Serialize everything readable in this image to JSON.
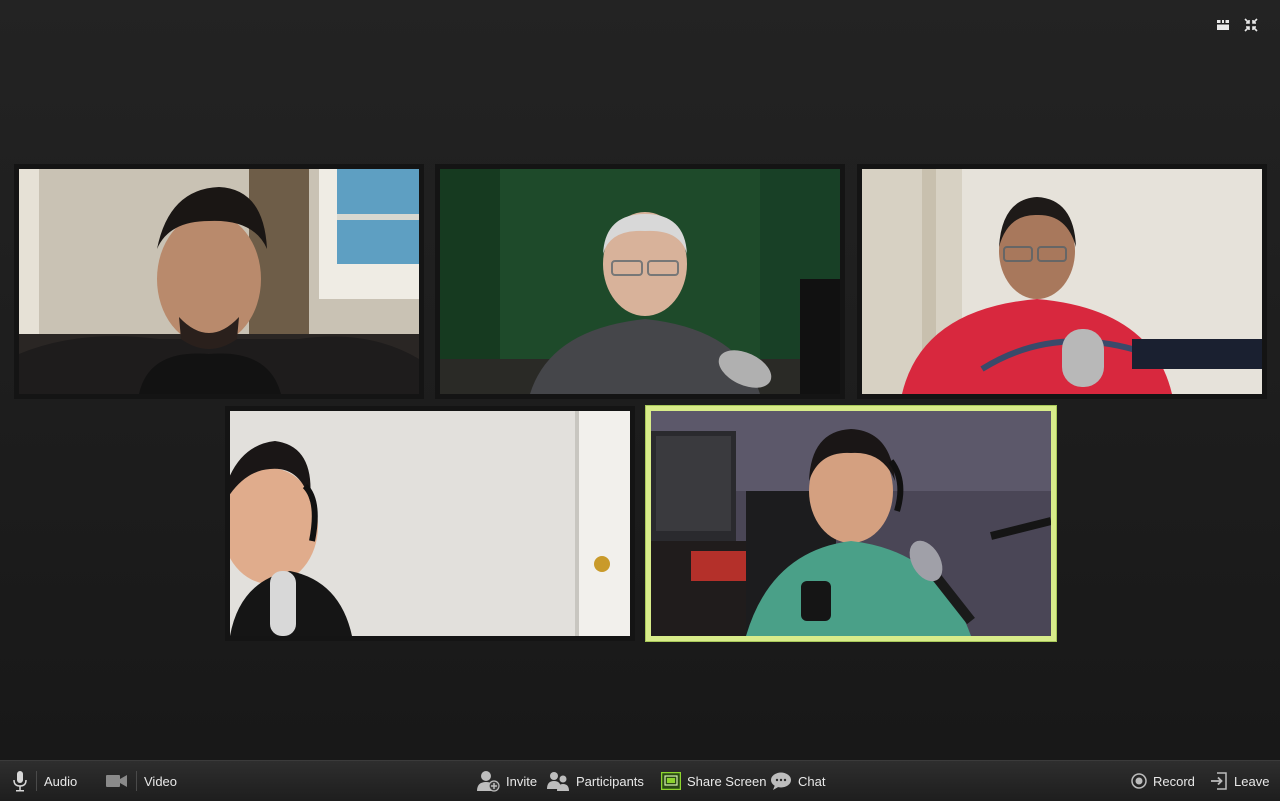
{
  "meeting": {
    "participants": [
      {
        "id": "p1",
        "active": false
      },
      {
        "id": "p2",
        "active": false
      },
      {
        "id": "p3",
        "active": false
      },
      {
        "id": "p4",
        "active": false
      },
      {
        "id": "p5",
        "active": true
      }
    ],
    "view_controls": {
      "gallery_icon": "grid-view-icon",
      "exit_fullscreen_icon": "exit-fullscreen-icon"
    }
  },
  "toolbar": {
    "audio_label": "Audio",
    "video_label": "Video",
    "invite_label": "Invite",
    "participants_label": "Participants",
    "share_screen_label": "Share Screen",
    "chat_label": "Chat",
    "record_label": "Record",
    "leave_label": "Leave",
    "share_accent": "#8cd42e",
    "active_speaker_color": "#d8ec8a"
  }
}
